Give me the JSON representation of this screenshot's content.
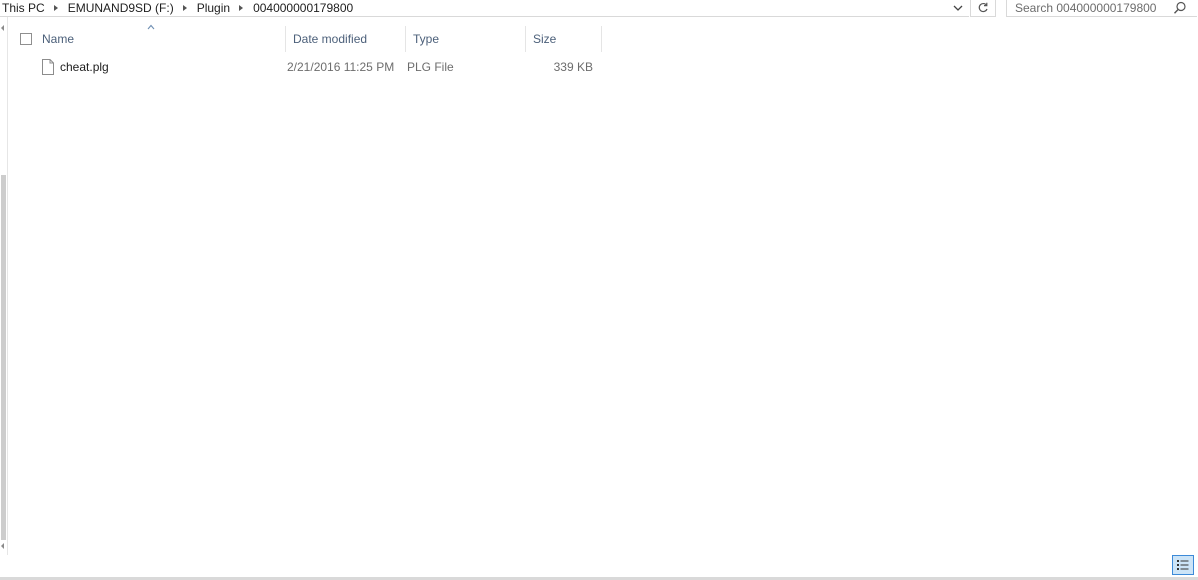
{
  "address_bar": {
    "crumbs": [
      "This PC",
      "EMUNAND9SD (F:)",
      "Plugin",
      "004000000179800"
    ]
  },
  "search": {
    "placeholder": "Search 004000000179800"
  },
  "columns": {
    "name": "Name",
    "date_modified": "Date modified",
    "type": "Type",
    "size": "Size"
  },
  "files": [
    {
      "name": "cheat.plg",
      "date_modified": "2/21/2016 11:25 PM",
      "type": "PLG File",
      "size": "339 KB",
      "icon": "document-file-icon"
    }
  ],
  "icons": {
    "address_dropdown": "chevron-down-icon",
    "refresh": "refresh-icon",
    "search": "search-icon",
    "sort": "sort-ascending-icon",
    "details_view": "details-view-icon"
  },
  "colors": {
    "header_text": "#4c607a",
    "secondary_text": "#6d6d6d",
    "view_toggle_border": "#3c8ad8",
    "view_toggle_fill": "#cce4f7"
  }
}
